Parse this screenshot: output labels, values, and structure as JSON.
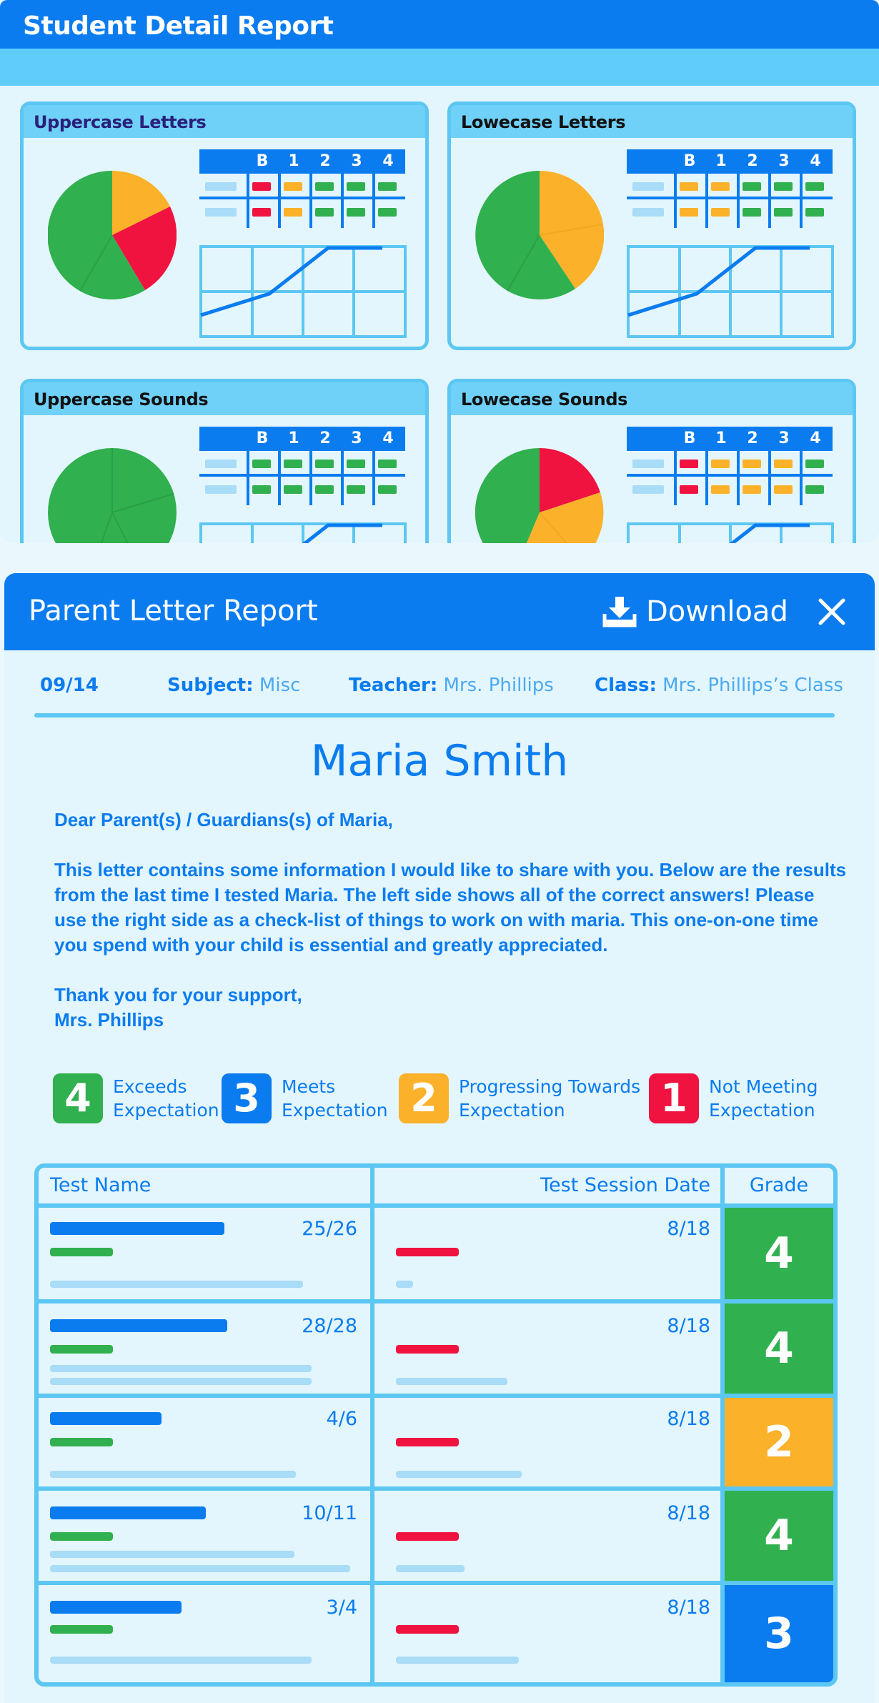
{
  "detail_report": {
    "title": "Student Detail Report",
    "grid_headers": [
      "B",
      "1",
      "2",
      "3",
      "4"
    ],
    "cards": [
      {
        "title": "Uppercase Letters",
        "pie_colors": [
          "#fbb12a",
          "#f0133f",
          "#30b04e"
        ]
      },
      {
        "title": "Lowecase Letters",
        "pie_colors": [
          "#fbb12a",
          "#30b04e"
        ]
      },
      {
        "title": "Uppercase Sounds",
        "pie_colors": [
          "#30b04e"
        ]
      },
      {
        "title": "Lowecase Sounds",
        "pie_colors": [
          "#f0133f",
          "#fbb12a",
          "#30b04e"
        ]
      }
    ]
  },
  "parent_letter": {
    "title": "Parent Letter Report",
    "download_label": "Download",
    "date": "09/14",
    "subject_label": "Subject:",
    "subject": "Misc",
    "teacher_label": "Teacher:",
    "teacher": "Mrs. Phillips",
    "class_label": "Class:",
    "class": "Mrs. Phillips’s Class",
    "student_name": "Maria Smith",
    "greeting": "Dear Parent(s) / Guardians(s) of Maria,",
    "body": "This letter contains some information I would like to share with you. Below are the results from the last time I tested Maria. The left side shows all of the correct answers! Please use the right side as a check-list of things to work on with maria. This one-on-one time you spend with your child is essential and greatly appreciated.",
    "closing": "Thank you for your support,",
    "signature": "Mrs. Phillips",
    "legend": [
      {
        "num": "4",
        "line1": "Exceeds",
        "line2": "Expectation",
        "color": "#30b04e"
      },
      {
        "num": "3",
        "line1": "Meets",
        "line2": "Expectation",
        "color": "#0a7cf0"
      },
      {
        "num": "2",
        "line1": "Progressing Towards",
        "line2": "Expectation",
        "color": "#fbb12a"
      },
      {
        "num": "1",
        "line1": "Not Meeting",
        "line2": "Expectation",
        "color": "#f0133f"
      }
    ],
    "table": {
      "headers": [
        "Test Name",
        "Test Session Date",
        "Grade"
      ],
      "rows": [
        {
          "score": "25/26",
          "date": "8/18",
          "grade": "4",
          "grade_color": "#30b04e"
        },
        {
          "score": "28/28",
          "date": "8/18",
          "grade": "4",
          "grade_color": "#30b04e"
        },
        {
          "score": "4/6",
          "date": "8/18",
          "grade": "2",
          "grade_color": "#fbb12a"
        },
        {
          "score": "10/11",
          "date": "8/18",
          "grade": "4",
          "grade_color": "#30b04e"
        },
        {
          "score": "3/4",
          "date": "8/18",
          "grade": "3",
          "grade_color": "#0a7cf0"
        }
      ]
    }
  }
}
